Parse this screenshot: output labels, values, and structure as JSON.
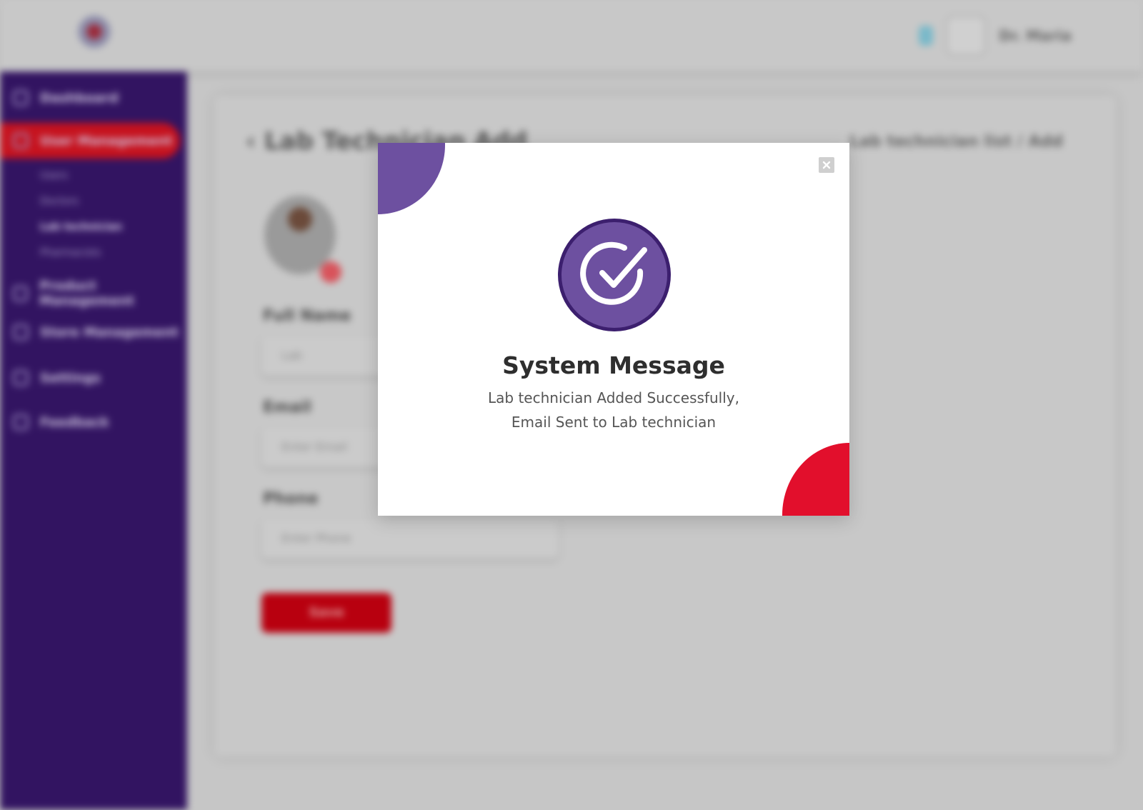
{
  "header": {
    "user_name": "Dr. Maria"
  },
  "sidebar": {
    "items": [
      {
        "label": "Dashboard",
        "icon": "grid-icon"
      },
      {
        "label": "User Management",
        "icon": "users-icon"
      },
      {
        "label": "Product Management",
        "icon": "box-icon"
      },
      {
        "label": "Store Management",
        "icon": "store-icon"
      },
      {
        "label": "Settings",
        "icon": "gear-icon"
      },
      {
        "label": "Feedback",
        "icon": "feedback-icon"
      }
    ],
    "sub_items": [
      {
        "label": "Users"
      },
      {
        "label": "Doctors"
      },
      {
        "label": "Lab technician"
      },
      {
        "label": "Pharmacists"
      }
    ]
  },
  "page": {
    "title": "Lab Technician Add",
    "breadcrumb": "Lab technician list / Add",
    "fields": [
      {
        "label": "Full Name",
        "placeholder": "Lab"
      },
      {
        "label": "Email",
        "placeholder": "Enter Email"
      },
      {
        "label": "Phone",
        "placeholder": "Enter Phone"
      }
    ],
    "save_label": "Save"
  },
  "modal": {
    "title": "System Message",
    "line1": "Lab technician Added Successfully,",
    "line2": "Email Sent to Lab technician"
  },
  "colors": {
    "sidebar": "#321461",
    "accent_red": "#e20f2c",
    "accent_purple": "#6d50a0"
  }
}
